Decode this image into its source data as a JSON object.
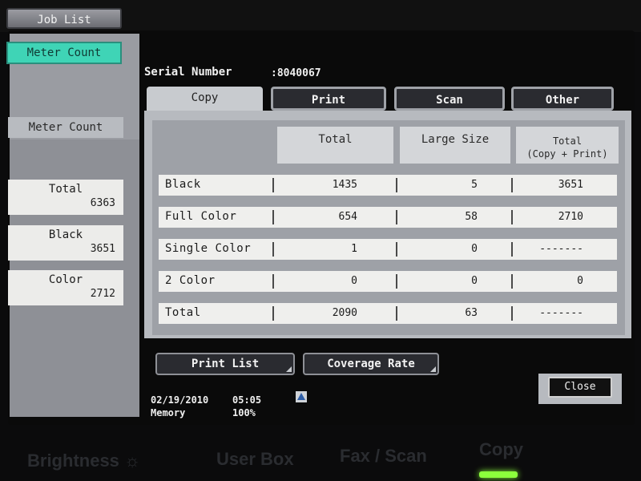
{
  "left_panel": {
    "job_list": "Job List",
    "meter_count_tab": "Meter Count",
    "meter_count_title": "Meter Count",
    "boxes": [
      {
        "label": "Total",
        "value": "6363"
      },
      {
        "label": "Black",
        "value": "3651"
      },
      {
        "label": "Color",
        "value": "2712"
      }
    ]
  },
  "header": {
    "serial_label": "Serial Number",
    "serial_value": ":8040067"
  },
  "tabs": [
    {
      "label": "Copy",
      "active": true
    },
    {
      "label": "Print",
      "active": false
    },
    {
      "label": "Scan",
      "active": false
    },
    {
      "label": "Other",
      "active": false
    }
  ],
  "table": {
    "headers": [
      "Total",
      "Large Size",
      "Total",
      "(Copy + Print)"
    ],
    "rows": [
      {
        "label": "Black",
        "total": "1435",
        "large": "5",
        "copy_print": "3651"
      },
      {
        "label": "Full Color",
        "total": "654",
        "large": "58",
        "copy_print": "2710"
      },
      {
        "label": "Single Color",
        "total": "1",
        "large": "0",
        "copy_print": "-------"
      },
      {
        "label": "2 Color",
        "total": "0",
        "large": "0",
        "copy_print": "0"
      },
      {
        "label": "Total",
        "total": "2090",
        "large": "63",
        "copy_print": "-------"
      }
    ]
  },
  "buttons": {
    "print_list": "Print List",
    "coverage_rate": "Coverage Rate",
    "close": "Close"
  },
  "status": {
    "date": "02/19/2010",
    "time": "05:05",
    "memory_label": "Memory",
    "memory_value": "100%"
  },
  "hardware": {
    "brightness": "Brightness ☼",
    "user_box": "User Box",
    "fax_scan": "Fax / Scan",
    "copy": "Copy"
  },
  "colors": {
    "active_tab": "#3fd4b6",
    "panel": "#b7babf",
    "led": "#8cff3c"
  }
}
